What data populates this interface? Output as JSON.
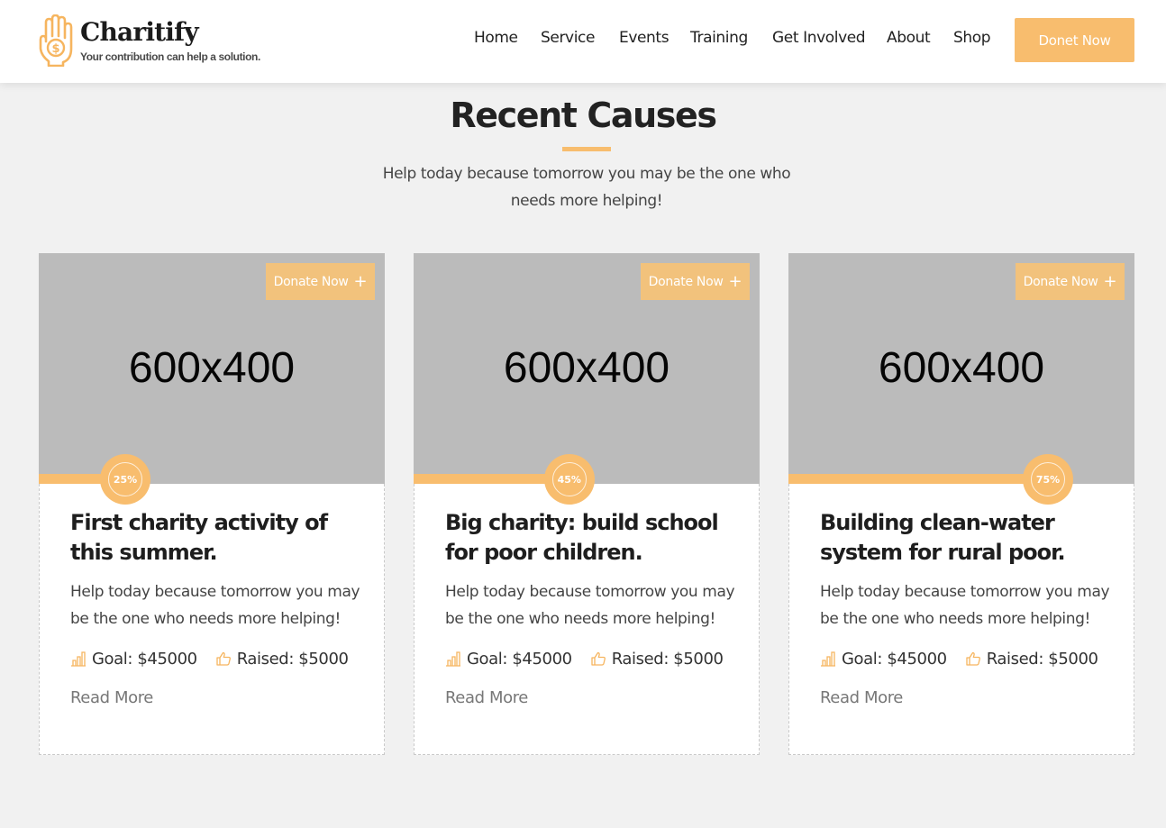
{
  "header": {
    "brand": "Charitify",
    "tagline": "Your contribution can help a solution.",
    "nav": [
      "Home",
      "Service",
      "Events",
      "Training",
      "Get Involved",
      "About",
      "Shop"
    ],
    "cta_label": "Donet Now"
  },
  "section": {
    "title": "Recent Causes",
    "subtitle": "Help today because tomorrow you may be the one who needs more helping!"
  },
  "colors": {
    "accent": "#f8bd6e",
    "placeholder": "#bbbbbb"
  },
  "causes": [
    {
      "image_label": "600x400",
      "donate_label": "Donate Now",
      "progress": 25,
      "progress_label": "25%",
      "title": "First charity activity of this summer.",
      "text": "Help today because tomorrow you may be the one who needs more helping!",
      "goal": "Goal: $45000",
      "raised": "Raised: $5000",
      "read_more": "Read More"
    },
    {
      "image_label": "600x400",
      "donate_label": "Donate Now",
      "progress": 45,
      "progress_label": "45%",
      "title": "Big charity: build school for poor children.",
      "text": "Help today because tomorrow you may be the one who needs more helping!",
      "goal": "Goal: $45000",
      "raised": "Raised: $5000",
      "read_more": "Read More"
    },
    {
      "image_label": "600x400",
      "donate_label": "Donate Now",
      "progress": 75,
      "progress_label": "75%",
      "title": "Building clean-water system for rural poor.",
      "text": "Help today because tomorrow you may be the one who needs more helping!",
      "goal": "Goal: $45000",
      "raised": "Raised: $5000",
      "read_more": "Read More"
    }
  ]
}
